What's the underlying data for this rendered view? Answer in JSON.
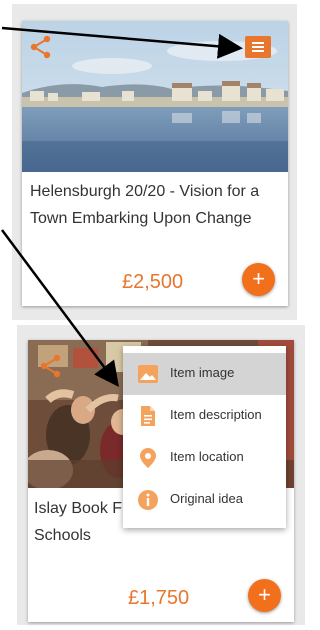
{
  "cards": [
    {
      "title": "Helensburgh 20/20 - Vision for a Town Embarking Upon Change",
      "price": "£2,500",
      "add_label": "+"
    },
    {
      "title": "Islay Book Festival for Schools",
      "title_visible": "Islay Book F",
      "title_line2": "Schools",
      "price": "£1,750",
      "add_label": "+"
    }
  ],
  "dropdown": {
    "items": [
      {
        "label": "Item image",
        "icon": "image-icon",
        "active": true
      },
      {
        "label": "Item description",
        "icon": "document-icon",
        "active": false
      },
      {
        "label": "Item location",
        "icon": "location-pin-icon",
        "active": false
      },
      {
        "label": "Original idea",
        "icon": "info-icon",
        "active": false
      }
    ]
  },
  "colors": {
    "accent": "#e8762d",
    "add_button": "#f26f1c",
    "panel": "#e9e9e9",
    "active_item": "#d4d4d4"
  }
}
